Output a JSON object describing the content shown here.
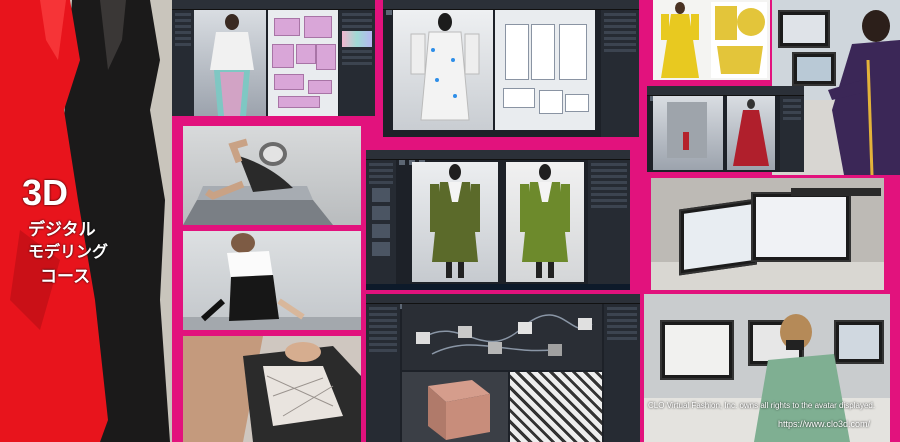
{
  "banner": {
    "title_main": "3D",
    "title_line1": "デジタル",
    "title_line2": "モデリング",
    "title_line3": "コース"
  },
  "credits": {
    "rights_notice": "CLO Virtual Fashion, Inc. owns all rights to the avatar displayed.",
    "url": "https://www.clo3d.com/"
  },
  "colors": {
    "background": "#e2127d",
    "title_shape": "#e8141c",
    "app_ui": "#1d2128"
  }
}
